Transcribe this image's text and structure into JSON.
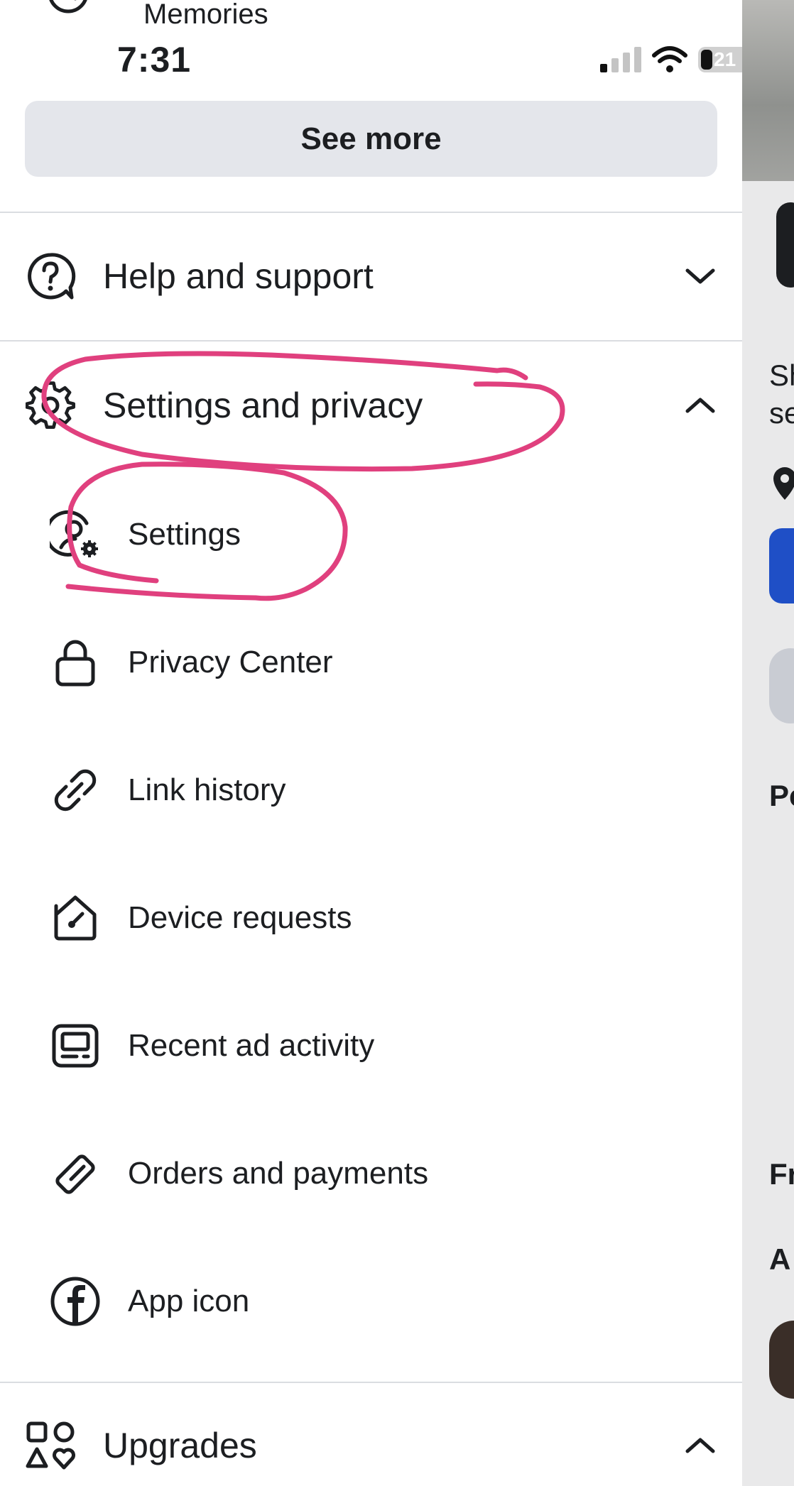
{
  "status_bar": {
    "time": "7:31",
    "battery": "21"
  },
  "top_item": {
    "label": "Memories"
  },
  "see_more": {
    "label": "See more"
  },
  "sections": {
    "help": {
      "label": "Help and support"
    },
    "settings_privacy": {
      "label": "Settings and privacy"
    },
    "upgrades": {
      "label": "Upgrades"
    }
  },
  "settings_items": [
    {
      "label": "Settings",
      "icon": "user-gear-icon"
    },
    {
      "label": "Privacy Center",
      "icon": "lock-icon"
    },
    {
      "label": "Link history",
      "icon": "link-icon"
    },
    {
      "label": "Device requests",
      "icon": "house-key-icon"
    },
    {
      "label": "Recent ad activity",
      "icon": "ad-screen-icon"
    },
    {
      "label": "Orders and payments",
      "icon": "ticket-icon"
    },
    {
      "label": "App icon",
      "icon": "facebook-icon"
    }
  ],
  "right_panel": {
    "text_lines": [
      "Sh",
      "se",
      "Pe",
      "Fr",
      "A"
    ]
  },
  "annotation_color": "#e0407e"
}
